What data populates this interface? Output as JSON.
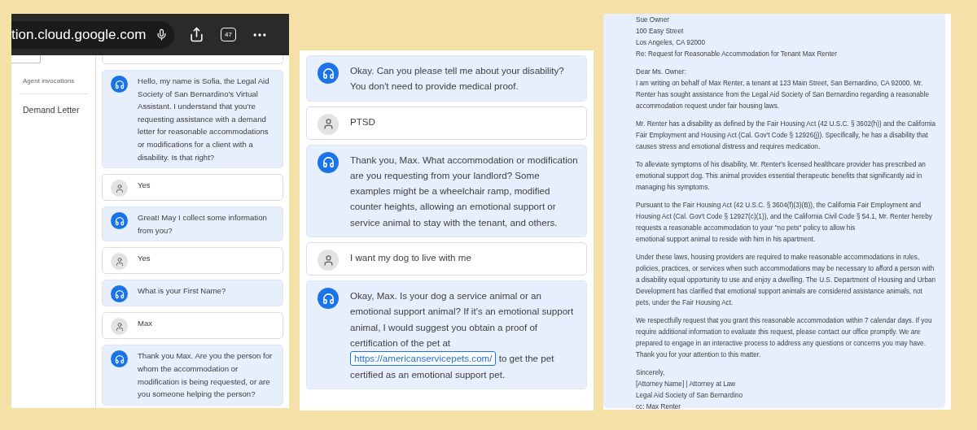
{
  "browser_bar": {
    "url": "tion.cloud.google.com",
    "tab_count": "47"
  },
  "sidebar": {
    "section_label": "Agent invocations",
    "items": [
      {
        "label": "Demand Letter",
        "selected": false
      }
    ]
  },
  "chat_left": [
    {
      "kind": "agent",
      "text": "Hello, my name is Sofia, the Legal Aid Society of San Bernardino's Virtual Assistant. I understand that you're requesting assistance with a demand letter for reasonable accommodations or modifications for a client with a disability. Is that right?"
    },
    {
      "kind": "user",
      "text": "Yes"
    },
    {
      "kind": "agent",
      "text": "Great! May I collect some information from you?"
    },
    {
      "kind": "user",
      "text": "Yes"
    },
    {
      "kind": "agent",
      "text": "What is your First Name?"
    },
    {
      "kind": "user",
      "text": "Max"
    },
    {
      "kind": "agent",
      "text": "Thank you Max. Are you the person for whom the accommodation or modification is being requested, or are you someone helping the person?"
    }
  ],
  "chat_middle": [
    {
      "kind": "agent",
      "text": "Okay. Can you please tell me about your disability? You don't need to provide medical proof."
    },
    {
      "kind": "user",
      "text": "PTSD"
    },
    {
      "kind": "agent",
      "text": "Thank you, Max. What accommodation or modification are you requesting from your landlord? Some examples might be a wheelchair ramp, modified counter heights, allowing an emotional support or service animal to stay with the tenant, and others."
    },
    {
      "kind": "user",
      "text": "I want my dog to live with me"
    },
    {
      "kind": "agent",
      "text": "Okay, Max. Is your dog a service animal or an emotional support animal? If it's an emotional support animal, I would suggest you obtain a proof of certification of the pet at",
      "link": "https://americanservicepets.com/",
      "text_after": "to get the pet certified as an emotional support pet."
    }
  ],
  "letter": {
    "address": [
      "Sue Owner",
      "100 Easy Street",
      "Los Angeles, CA 92000",
      "Re: Request for Reasonable Accommodation for Tenant Max Renter"
    ],
    "salutation": "Dear Ms. Owner:",
    "paragraphs": [
      "I am writing on behalf of Max Renter, a tenant at 123 Main Street, San Bernardino, CA 92000. Mr. Renter has sought assistance from the Legal Aid Society of San Bernardino regarding a reasonable accommodation request under fair housing laws.",
      "Mr. Renter has a disability as defined by the Fair Housing Act (42 U.S.C. § 3602(h)) and the California Fair Employment and Housing Act (Cal. Gov't Code § 12926(j)). Specifically, he has a disability that causes stress and emotional distress and requires medication.",
      "To alleviate symptoms of his disability, Mr. Renter's licensed healthcare provider has prescribed an emotional support dog. This animal provides essential therapeutic benefits that significantly aid in managing his symptoms.",
      "Pursuant to the Fair Housing Act (42 U.S.C. § 3604(f)(3)(B)), the California Fair Employment and Housing Act (Cal. Gov't Code § 12927(c)(1)), and the California Civil Code § 54.1, Mr. Renter hereby requests a reasonable accommodation to your \"no pets\" policy to allow his",
      "emotional support animal to reside with him in his apartment.",
      "Under these laws, housing providers are required to make reasonable accommodations in rules, policies, practices, or services when such accommodations may be necessary to afford a person with a disability equal opportunity to use and enjoy a dwelling. The U.S. Department of Housing and Urban Development has clarified that emotional support animals are considered assistance animals, not pets, under the Fair Housing Act.",
      "We respectfully request that you grant this reasonable accommodation within 7 calendar days. If you require additional information to evaluate this request, please contact our office promptly. We are prepared to engage in an interactive process to address any questions or concerns you may have. Thank you for your attention to this matter."
    ],
    "closing": [
      "Sincerely,",
      "[Attorney Name] | Attorney at Law",
      "Legal Aid Society of San Bernardino",
      "cc: Max Renter"
    ]
  }
}
